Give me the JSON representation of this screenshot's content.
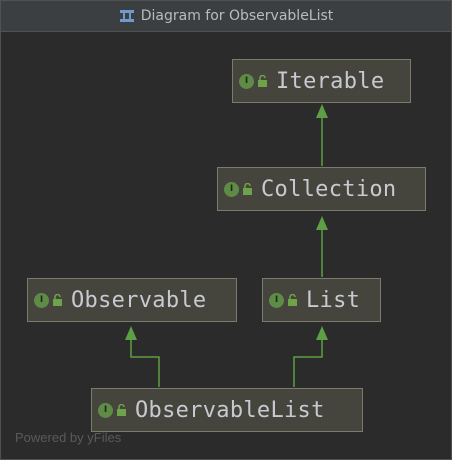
{
  "window": {
    "title": "Diagram for ObservableList"
  },
  "nodes": {
    "iterable": {
      "label": "Iterable",
      "kind": "I"
    },
    "collection": {
      "label": "Collection",
      "kind": "I"
    },
    "observable": {
      "label": "Observable",
      "kind": "I"
    },
    "list": {
      "label": "List",
      "kind": "I"
    },
    "observablelist": {
      "label": "ObservableList",
      "kind": "I"
    }
  },
  "edges": [
    {
      "from": "collection",
      "to": "iterable",
      "type": "extends"
    },
    {
      "from": "list",
      "to": "collection",
      "type": "extends"
    },
    {
      "from": "observablelist",
      "to": "observable",
      "type": "extends"
    },
    {
      "from": "observablelist",
      "to": "list",
      "type": "extends"
    }
  ],
  "watermark": "Powered by yFiles",
  "colors": {
    "edge": "#5d9f44",
    "interface_badge": "#5e8c47",
    "node_bg": "#45443d",
    "node_border": "#7b7a6e"
  },
  "icons": {
    "title": "diagram-icon",
    "badge": "interface-icon",
    "access": "unlocked-icon"
  }
}
